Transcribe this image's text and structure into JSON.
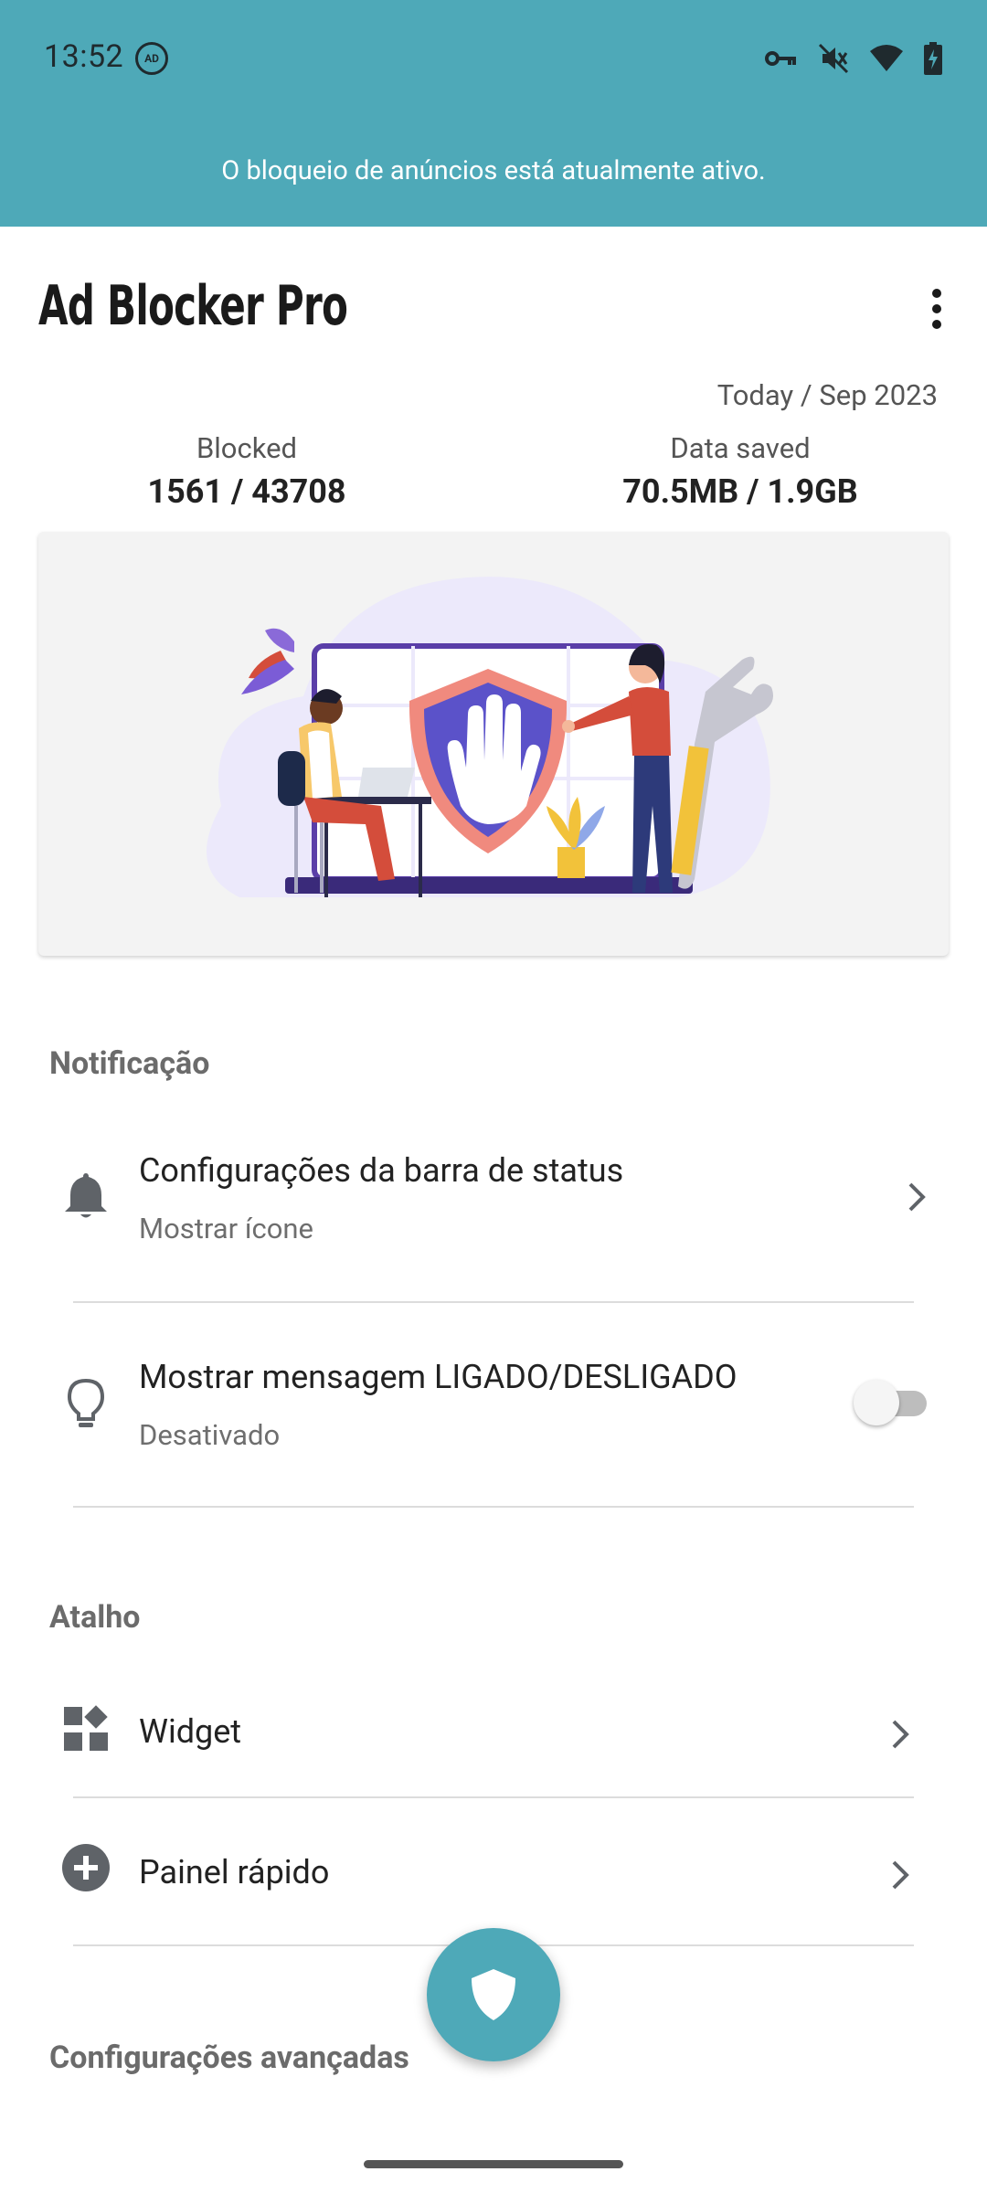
{
  "status_bar": {
    "time": "13:52",
    "ad_badge": "AD"
  },
  "banner": {
    "text": "O bloqueio de anúncios está atualmente ativo."
  },
  "header": {
    "title": "Ad Blocker Pro"
  },
  "stats": {
    "period": "Today / Sep 2023",
    "blocked_label": "Blocked",
    "blocked_value": "1561 / 43708",
    "data_label": "Data saved",
    "data_value": "70.5MB / 1.9GB"
  },
  "sections": {
    "notification": {
      "header": "Notificação",
      "status_bar_settings": {
        "title": "Configurações da barra de status",
        "subtitle": "Mostrar ícone"
      },
      "on_off_message": {
        "title": "Mostrar mensagem LIGADO/DESLIGADO",
        "subtitle": "Desativado",
        "enabled": false
      }
    },
    "shortcut": {
      "header": "Atalho",
      "widget": {
        "title": "Widget"
      },
      "quick_panel": {
        "title": "Painel rápido"
      }
    },
    "advanced": {
      "header": "Configurações avançadas"
    }
  },
  "colors": {
    "accent": "#4ea9b8",
    "section_header": "#6b6b6b",
    "illustration_shield": "#5b52c9",
    "illustration_shield_border": "#f08a7e"
  },
  "icons": {
    "status_bar_settings": "bell-icon",
    "on_off_message": "lightbulb-icon",
    "widget": "widgets-icon",
    "quick_panel": "add-circle-icon",
    "fab": "shield-icon"
  }
}
